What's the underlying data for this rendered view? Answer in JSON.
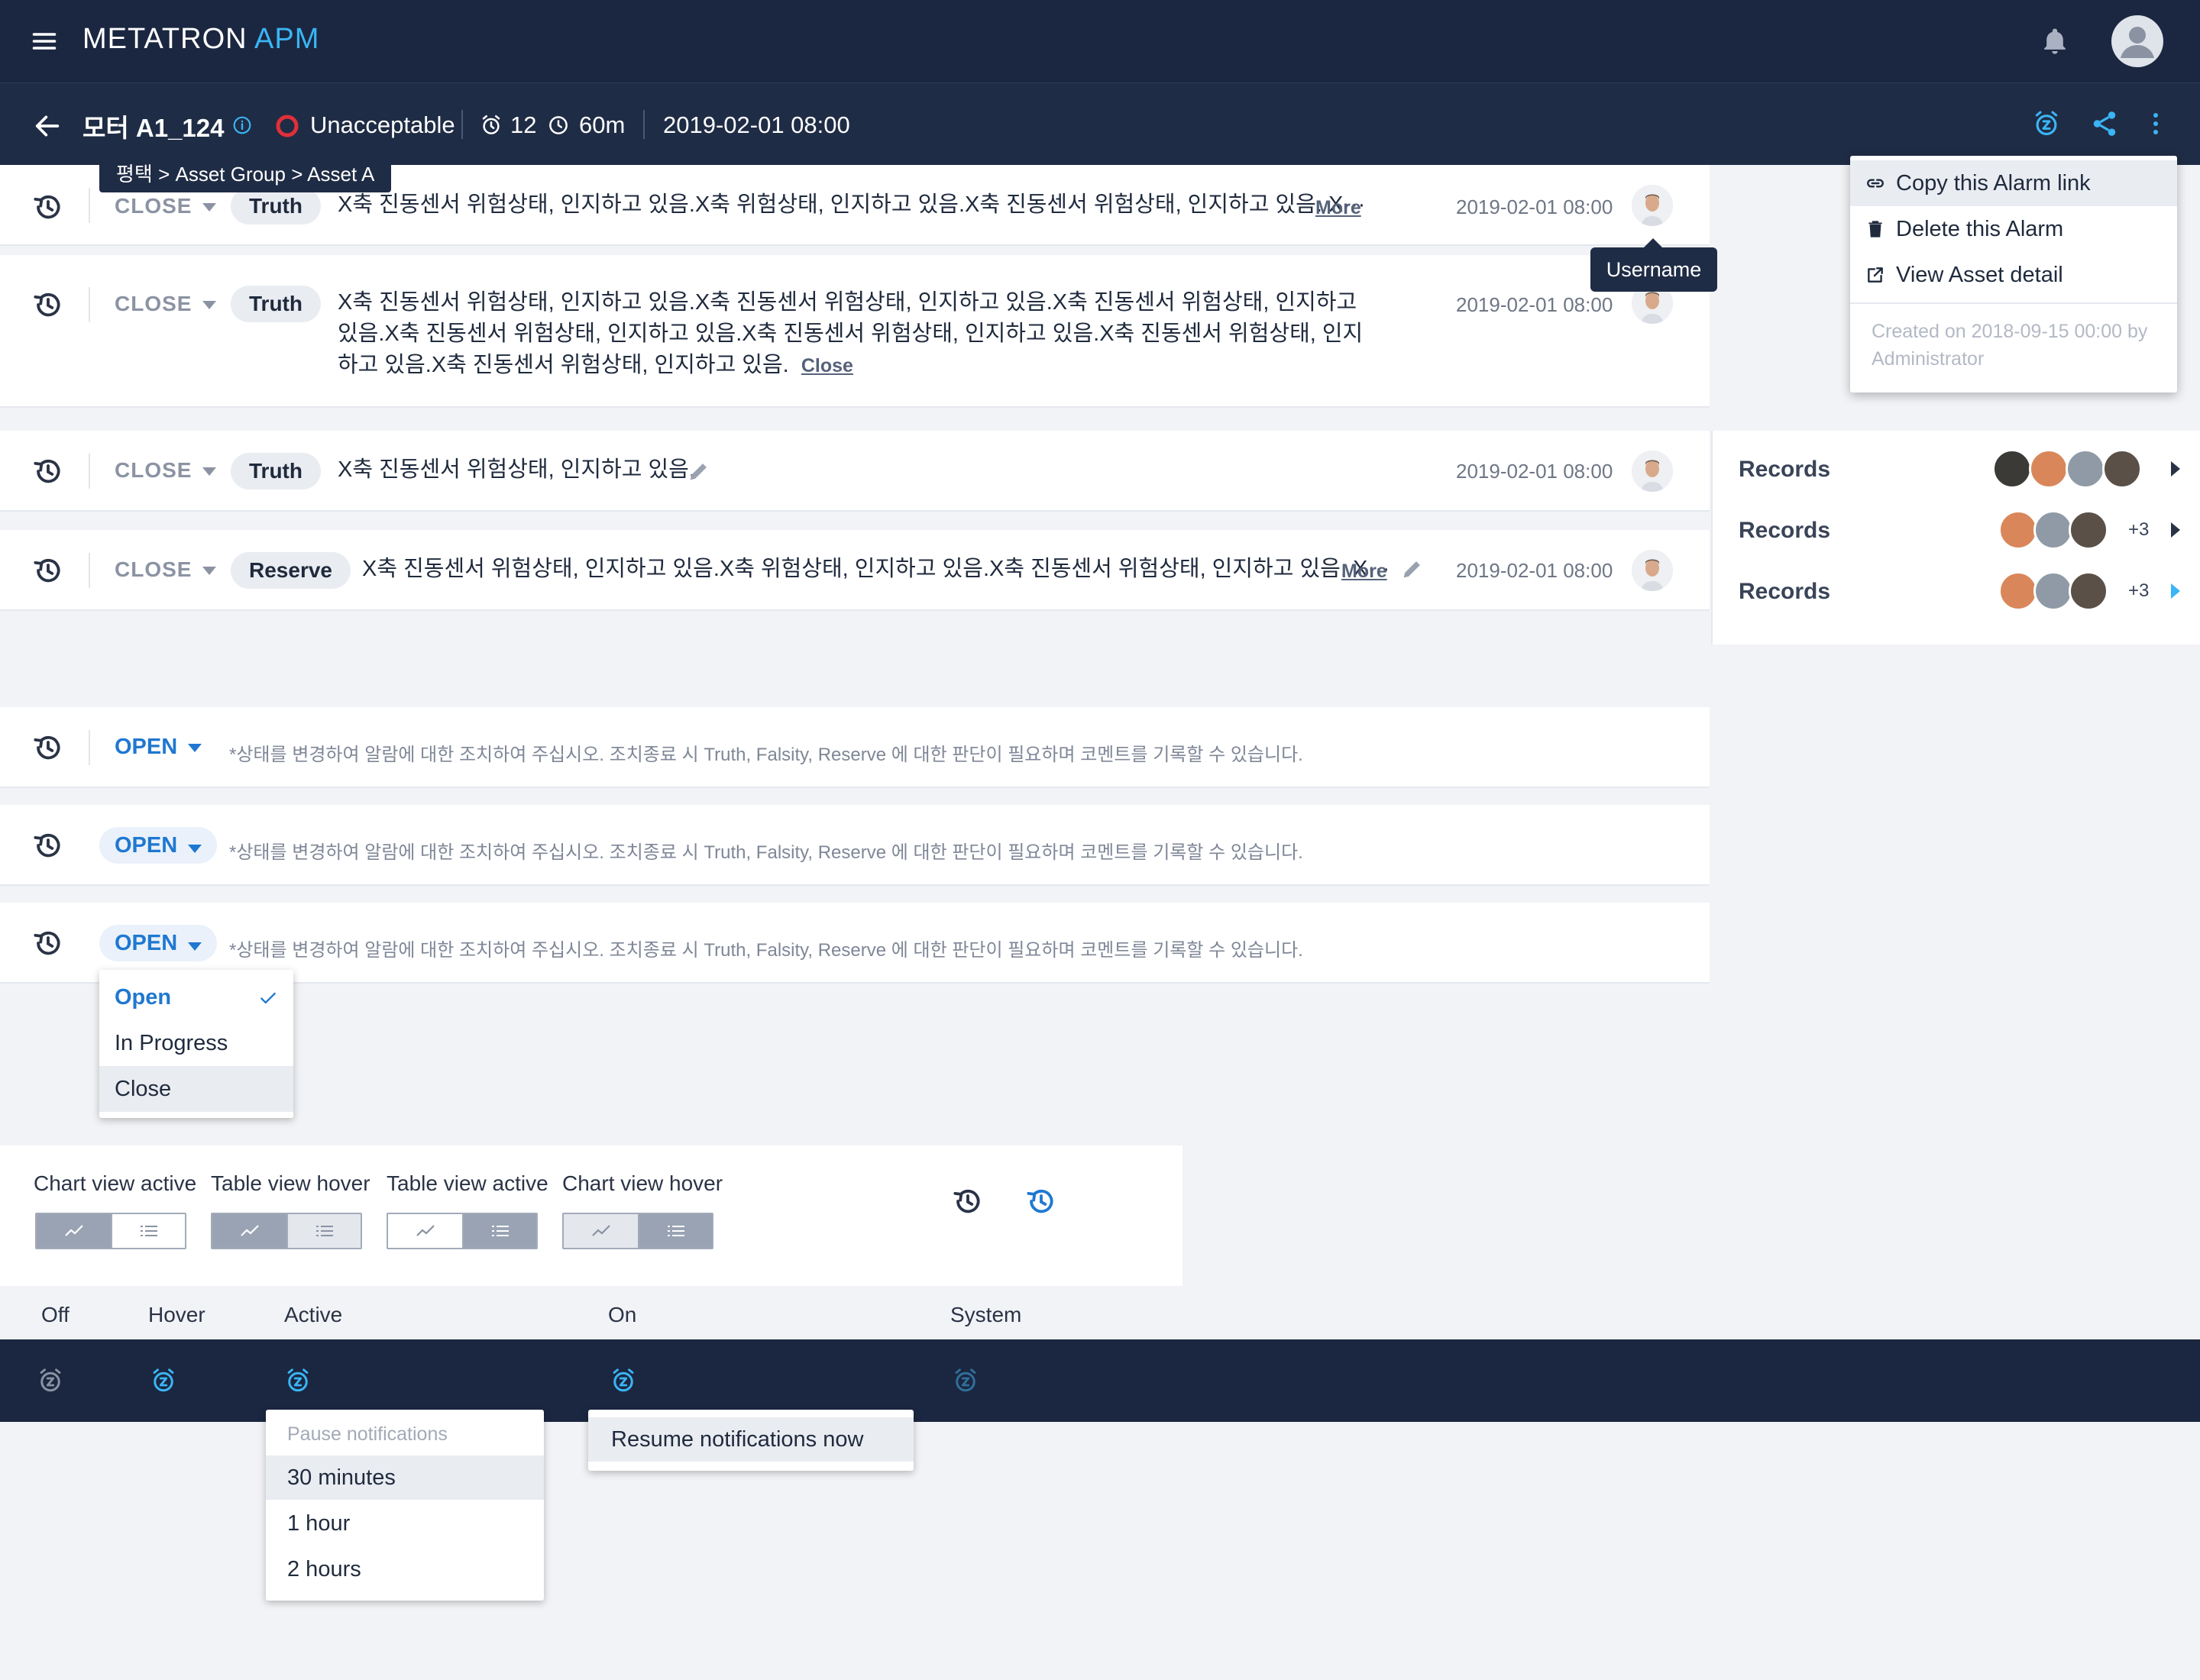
{
  "app": {
    "brand_main": "METATRON",
    "brand_suffix": "APM"
  },
  "colors": {
    "nav_bg": "#1b2740",
    "subbar_bg": "#1f2c45",
    "accent": "#3ab5f5",
    "link_blue": "#1f78d1",
    "alarm_red": "#e0303a"
  },
  "header": {
    "asset_name": "모터 A1_124",
    "severity": "Unacceptable",
    "alarm_count": "12",
    "duration": "60m",
    "datetime": "2019-02-01 08:00",
    "breadcrumb": "평택 > Asset Group > Asset A"
  },
  "more_menu": {
    "items": [
      {
        "label": "Copy this Alarm link",
        "icon": "link-icon"
      },
      {
        "label": "Delete this Alarm",
        "icon": "trash-icon"
      },
      {
        "label": "View Asset detail",
        "icon": "external-link-icon"
      }
    ],
    "meta": "Created on 2018-09-15 00:00 by Administrator"
  },
  "tooltip": {
    "username": "Username"
  },
  "closed_rows": [
    {
      "status": "CLOSE",
      "tag": "Truth",
      "comment": "X축 진동센서 위험상태, 인지하고 있음.X축  위험상태, 인지하고 있음.X축 진동센서 위험상태, 인지하고 있음. X···",
      "link": "More",
      "timestamp": "2019-02-01 08:00"
    },
    {
      "status": "CLOSE",
      "tag": "Truth",
      "comment": "X축 진동센서 위험상태, 인지하고 있음.X축 진동센서 위험상태, 인지하고 있음.X축 진동센서 위험상태, 인지하고 있음.X축 진동센서 위험상태, 인지하고 있음.X축 진동센서 위험상태, 인지하고 있음.X축 진동센서 위험상태, 인지하고 있음.X축 진동센서 위험상태, 인지하고 있음.",
      "link": "Close",
      "timestamp": "2019-02-01 08:00"
    },
    {
      "status": "CLOSE",
      "tag": "Truth",
      "comment": "X축 진동센서 위험상태, 인지하고 있음.",
      "link": "",
      "timestamp": "2019-02-01 08:00"
    },
    {
      "status": "CLOSE",
      "tag": "Reserve",
      "comment": "X축 진동센서 위험상태, 인지하고 있음.X축  위험상태, 인지하고 있음.X축 진동센서 위험상태, 인지하고 있음. X···",
      "link": "More",
      "timestamp": "2019-02-01 08:00"
    }
  ],
  "records": [
    {
      "label": "Records",
      "extra": ""
    },
    {
      "label": "Records",
      "extra": "+3"
    },
    {
      "label": "Records",
      "extra": "+3"
    }
  ],
  "open_rows": [
    {
      "status": "OPEN",
      "hint": "*상태를 변경하여 알람에 대한 조치하여 주십시오. 조치종료 시 Truth, Falsity, Reserve 에 대한 판단이 필요하며 코멘트를 기록할 수 있습니다."
    },
    {
      "status": "OPEN",
      "hint": "*상태를 변경하여 알람에 대한 조치하여 주십시오. 조치종료 시 Truth, Falsity, Reserve 에 대한 판단이 필요하며 코멘트를 기록할 수 있습니다."
    },
    {
      "status": "OPEN",
      "hint": "*상태를 변경하여 알람에 대한 조치하여 주십시오. 조치종료 시 Truth, Falsity, Reserve 에 대한 판단이 필요하며 코멘트를 기록할 수 있습니다."
    }
  ],
  "status_menu": {
    "options": [
      "Open",
      "In Progress",
      "Close"
    ],
    "selected": "Open",
    "hovered": "Close"
  },
  "view_toggles": {
    "labels": [
      "Chart view active",
      "Table view hover",
      "Table view active",
      "Chart view hover"
    ]
  },
  "notification_states": {
    "labels": [
      "Off",
      "Hover",
      "Active",
      "On",
      "System"
    ]
  },
  "pause_menu": {
    "header": "Pause notifications",
    "options": [
      "30 minutes",
      "1 hour",
      "2 hours"
    ]
  },
  "resume_menu": {
    "label": "Resume notifications now"
  }
}
